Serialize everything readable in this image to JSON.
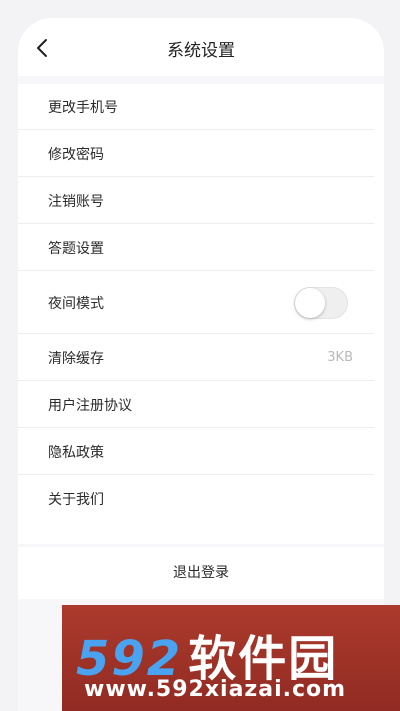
{
  "header": {
    "title": "系统设置",
    "back_icon": "chevron-left-icon"
  },
  "settings": {
    "items": [
      {
        "label": "更改手机号"
      },
      {
        "label": "修改密码"
      },
      {
        "label": "注销账号"
      },
      {
        "label": "答题设置"
      },
      {
        "label": "夜间模式",
        "toggle_on": false
      },
      {
        "label": "清除缓存",
        "value": "3KB"
      },
      {
        "label": "用户注册协议"
      },
      {
        "label": "隐私政策"
      },
      {
        "label": "关于我们"
      }
    ]
  },
  "logout": {
    "label": "退出登录"
  },
  "watermark": {
    "logo_num": "592",
    "logo_cn": "软件园",
    "url": "www.592xiazai.com",
    "colors": {
      "background": "#ac3a2c",
      "logo_num": "#4aa3f0",
      "text": "#ffffff"
    }
  }
}
